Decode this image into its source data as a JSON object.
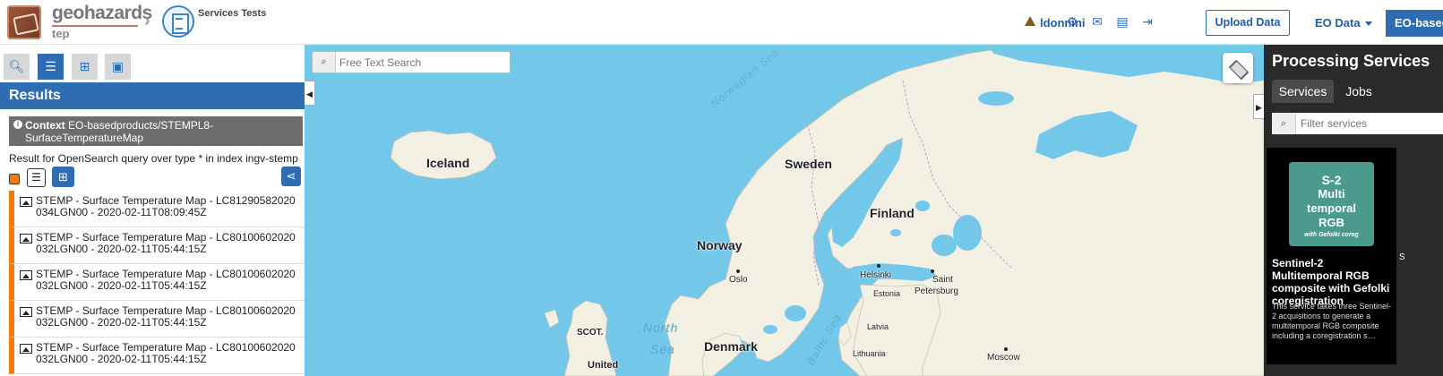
{
  "header": {
    "logo_name": "geohazards",
    "logo_sub": "tep",
    "breadcrumb_title": "Services Tests",
    "user_name": "ldonnini",
    "upload_label": "Upload Data",
    "eo_data_label": "EO Data",
    "eo_based_label": "EO-based"
  },
  "left_panel": {
    "results_title": "Results",
    "context_label": "Context",
    "context_value": "EO-basedproducts/STEMPL8-SurfaceTemperatureMap",
    "query_text": "Result for OpenSearch query over type * in index ingv-stemp",
    "results": [
      {
        "line1": "STEMP - Surface Temperature Map - LC81290582020",
        "line2": "034LGN00 - 2020-02-11T08:09:45Z"
      },
      {
        "line1": "STEMP - Surface Temperature Map - LC80100602020",
        "line2": "032LGN00 - 2020-02-11T05:44:15Z"
      },
      {
        "line1": "STEMP - Surface Temperature Map - LC80100602020",
        "line2": "032LGN00 - 2020-02-11T05:44:15Z"
      },
      {
        "line1": "STEMP - Surface Temperature Map - LC80100602020",
        "line2": "032LGN00 - 2020-02-11T05:44:15Z"
      },
      {
        "line1": "STEMP - Surface Temperature Map - LC80100602020",
        "line2": "032LGN00 - 2020-02-11T05:44:15Z"
      }
    ]
  },
  "map": {
    "search_placeholder": "Free Text Search",
    "labels": {
      "iceland": "Iceland",
      "sweden": "Sweden",
      "finland": "Finland",
      "norway": "Norway",
      "denmark": "Denmark",
      "oslo": "Oslo",
      "helsinki": "Helsinki",
      "saint": "Saint",
      "petersburg": "Petersburg",
      "estonia": "Estonia",
      "latvia": "Latvia",
      "lithuania": "Lithuania",
      "moscow": "Moscow",
      "scot": "SCOT.",
      "united": "United",
      "north_sea_1": "North",
      "north_sea_2": "Sea",
      "norwegian_sea": "Norwegian Sea",
      "baltic_sea": "Baltic Sea"
    }
  },
  "right_panel": {
    "title": "Processing Services",
    "tab_services": "Services",
    "tab_jobs": "Jobs",
    "filter_placeholder": "Filter services",
    "card": {
      "thumb_line1": "S-2",
      "thumb_line2": "Multi",
      "thumb_line3": "temporal",
      "thumb_line4": "RGB",
      "thumb_sub": "with Gefolki coreg",
      "name": "Sentinel-2 Multitemporal RGB composite with Gefolki coregistration",
      "description": "This service takes three Sentinel-2 acquisitions to generate a multitemporal RGB composite including a coregistration s…"
    },
    "next_card_fragment": "S"
  },
  "colors": {
    "accent_blue": "#2f6db3",
    "result_marker": "#f57c00",
    "sea": "#73c8ea",
    "land": "#f2efe3"
  }
}
